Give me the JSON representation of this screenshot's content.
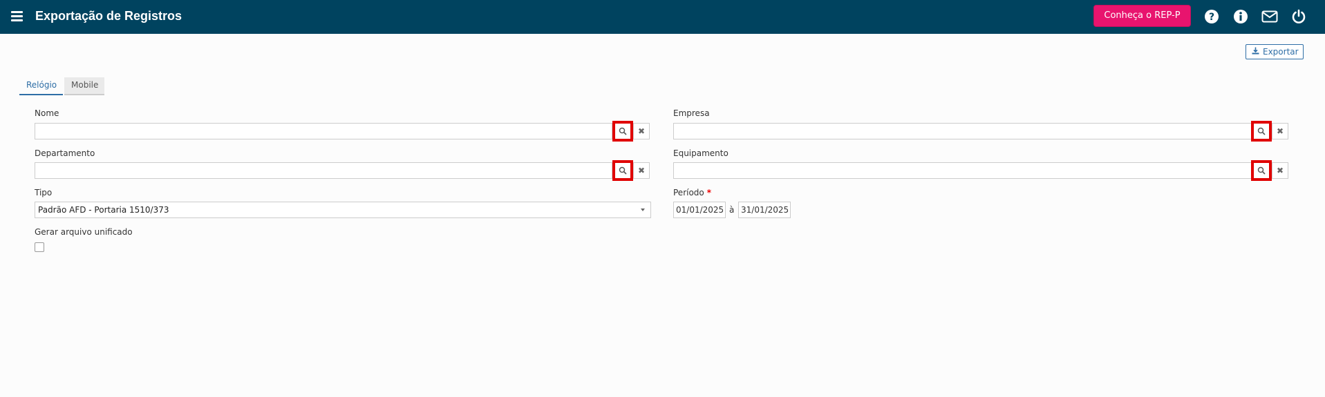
{
  "header": {
    "title": "Exportação de Registros",
    "promo_button": "Conheça o REP-P",
    "icons": [
      "help-icon",
      "info-icon",
      "mail-icon",
      "power-icon"
    ],
    "colors": {
      "bar": "#00435f",
      "promo": "#e8146e"
    }
  },
  "toolbar": {
    "export_label": "Exportar"
  },
  "tabs": [
    {
      "label": "Relógio",
      "active": true
    },
    {
      "label": "Mobile",
      "active": false
    }
  ],
  "form": {
    "nome": {
      "label": "Nome",
      "value": ""
    },
    "empresa": {
      "label": "Empresa",
      "value": ""
    },
    "departamento": {
      "label": "Departamento",
      "value": ""
    },
    "equipamento": {
      "label": "Equipamento",
      "value": ""
    },
    "tipo": {
      "label": "Tipo",
      "value": "Padrão AFD - Portaria 1510/373"
    },
    "periodo": {
      "label": "Período",
      "required_mark": "*",
      "start": "01/01/2025",
      "separator": "à",
      "end": "31/01/2025"
    },
    "unificado": {
      "label": "Gerar arquivo unificado",
      "checked": false
    }
  }
}
